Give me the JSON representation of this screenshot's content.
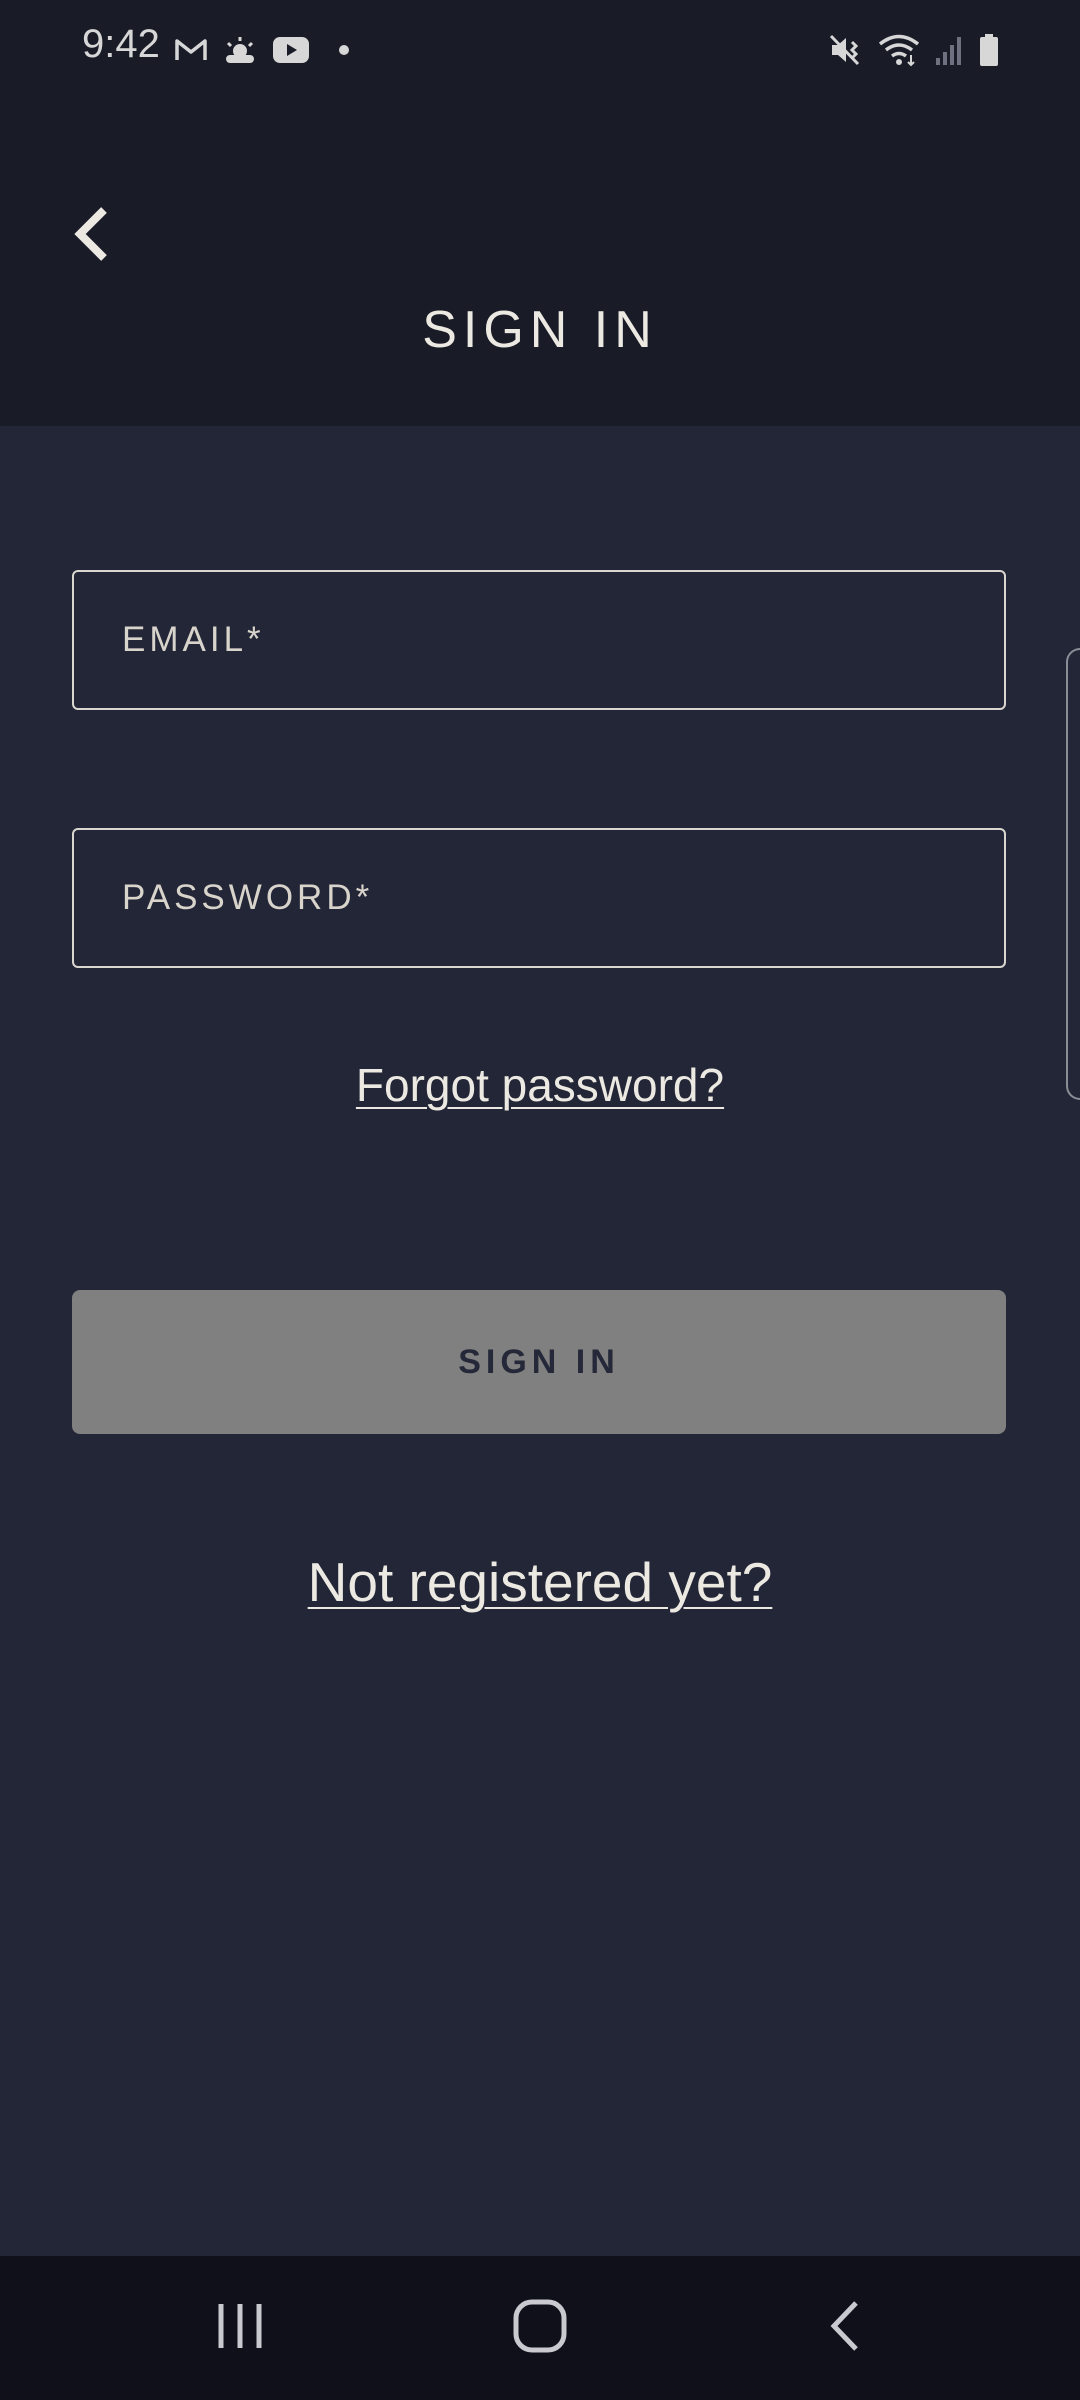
{
  "status_bar": {
    "time": "9:42",
    "left_icons": [
      "gmail-icon",
      "weather-sunrise-icon",
      "youtube-icon",
      "notification-dot-icon"
    ],
    "right_icons": [
      "mute-vibrate-icon",
      "wifi-icon",
      "signal-icon",
      "battery-icon"
    ]
  },
  "header": {
    "title": "SIGN IN",
    "back_icon": "chevron-left-icon"
  },
  "form": {
    "email_placeholder": "EMAIL*",
    "email_value": "",
    "password_placeholder": "PASSWORD*",
    "password_value": "",
    "forgot_password_label": "Forgot password?",
    "sign_in_label": "SIGN IN",
    "register_label": "Not registered yet?"
  },
  "nav_bar": {
    "recents_icon": "recents-icon",
    "home_icon": "home-icon",
    "back_icon": "back-icon"
  },
  "colors": {
    "background": "#232636",
    "header_background": "#191b27",
    "text": "#ece9e2",
    "button_disabled": "#808080",
    "button_text": "#252838",
    "nav_background": "#0f1019"
  }
}
